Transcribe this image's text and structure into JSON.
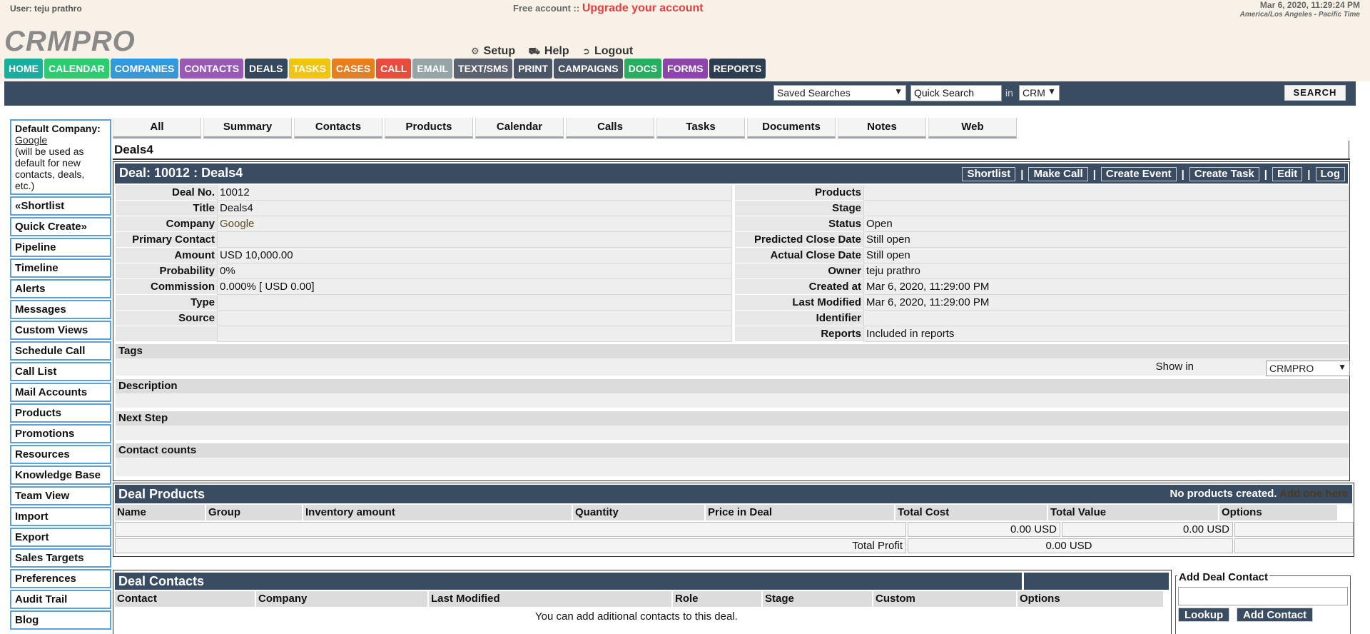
{
  "header": {
    "user_label": "User: teju prathro",
    "free_account": "Free account ::",
    "upgrade": "Upgrade your account",
    "datetime": "Mar 6, 2020, 11:29:24 PM",
    "timezone": "America/Los Angeles - Pacific Time",
    "logo": "CRMPRO",
    "setup": "Setup",
    "help": "Help",
    "logout": "Logout"
  },
  "nav": [
    {
      "label": "HOME",
      "color": "#1aae9f"
    },
    {
      "label": "CALENDAR",
      "color": "#2ecc71"
    },
    {
      "label": "COMPANIES",
      "color": "#3498db"
    },
    {
      "label": "CONTACTS",
      "color": "#9b59b6"
    },
    {
      "label": "DEALS",
      "color": "#34495e"
    },
    {
      "label": "TASKS",
      "color": "#f1c40f"
    },
    {
      "label": "CASES",
      "color": "#e67e22"
    },
    {
      "label": "CALL",
      "color": "#e74c3c"
    },
    {
      "label": "EMAIL",
      "color": "#95a5a6"
    },
    {
      "label": "TEXT/SMS",
      "color": "#5c6370"
    },
    {
      "label": "PRINT",
      "color": "#4a5668"
    },
    {
      "label": "CAMPAIGNS",
      "color": "#4a5668"
    },
    {
      "label": "DOCS",
      "color": "#27ae60"
    },
    {
      "label": "FORMS",
      "color": "#8e44ad"
    },
    {
      "label": "REPORTS",
      "color": "#2c3e50"
    }
  ],
  "search": {
    "saved_searches": "Saved Searches",
    "quick_search": "Quick Search",
    "in_label": "in",
    "scope": "CRM",
    "button": "SEARCH"
  },
  "sidebar": {
    "default_company_label": "Default Company:",
    "default_company": "Google",
    "default_company_note": "(will be used as default for new contacts, deals, etc.)",
    "items": [
      "«Shortlist",
      "Quick Create»",
      "Pipeline",
      "Timeline",
      "Alerts",
      "Messages",
      "Custom Views",
      "Schedule Call",
      "Call List",
      "Mail Accounts",
      "Products",
      "Promotions",
      "Resources",
      "Knowledge Base",
      "Team View",
      "Import",
      "Export",
      "Sales Targets",
      "Preferences",
      "Audit Trail",
      "Blog"
    ]
  },
  "tabs": [
    "All",
    "Summary",
    "Contacts",
    "Products",
    "Calendar",
    "Calls",
    "Tasks",
    "Documents",
    "Notes",
    "Web"
  ],
  "deal": {
    "name": "Deals4",
    "title": "Deal: 10012 : Deals4",
    "actions": [
      "Shortlist",
      "Make Call",
      "Create Event",
      "Create Task",
      "Edit",
      "Log"
    ],
    "left_fields": [
      {
        "label": "Deal No.",
        "value": "10012"
      },
      {
        "label": "Title",
        "value": "Deals4"
      },
      {
        "label": "Company",
        "value": "Google"
      },
      {
        "label": "Primary Contact",
        "value": ""
      },
      {
        "label": "Amount",
        "value": "USD 10,000.00"
      },
      {
        "label": "Probability",
        "value": "0%"
      },
      {
        "label": "Commission",
        "value": "0.000% [ USD 0.00]"
      },
      {
        "label": "Type",
        "value": ""
      },
      {
        "label": "Source",
        "value": ""
      },
      {
        "label": "",
        "value": ""
      }
    ],
    "right_fields": [
      {
        "label": "Products",
        "value": ""
      },
      {
        "label": "Stage",
        "value": ""
      },
      {
        "label": "Status",
        "value": "Open"
      },
      {
        "label": "Predicted Close Date",
        "value": "Still open"
      },
      {
        "label": "Actual Close Date",
        "value": "Still open"
      },
      {
        "label": "Owner",
        "value": "teju prathro"
      },
      {
        "label": "Created at",
        "value": "Mar 6, 2020, 11:29:00 PM"
      },
      {
        "label": "Last Modified",
        "value": "Mar 6, 2020, 11:29:00 PM"
      },
      {
        "label": "Identifier",
        "value": ""
      },
      {
        "label": "Reports",
        "value": "Included in reports"
      }
    ],
    "tags_label": "Tags",
    "show_in_label": "Show in",
    "show_in_value": "CRMPRO",
    "description_label": "Description",
    "next_step_label": "Next Step",
    "contact_counts_label": "Contact counts"
  },
  "products": {
    "title": "Deal Products",
    "none_text": "No products created.",
    "add_link": "Add one here",
    "columns": [
      "Name",
      "Group",
      "Inventory amount",
      "Quantity",
      "Price in Deal",
      "Total Cost",
      "Total Value",
      "Options"
    ],
    "total_cost": "0.00 USD",
    "total_value": "0.00 USD",
    "total_profit_label": "Total Profit",
    "total_profit": "0.00 USD"
  },
  "contacts": {
    "title": "Deal Contacts",
    "columns": [
      "Contact",
      "Company",
      "Last Modified",
      "Role",
      "Stage",
      "Custom",
      "Options"
    ],
    "note": "You can add aditional contacts to this deal.",
    "add_title": "Add Deal Contact",
    "lookup": "Lookup",
    "add_contact": "Add Contact"
  }
}
